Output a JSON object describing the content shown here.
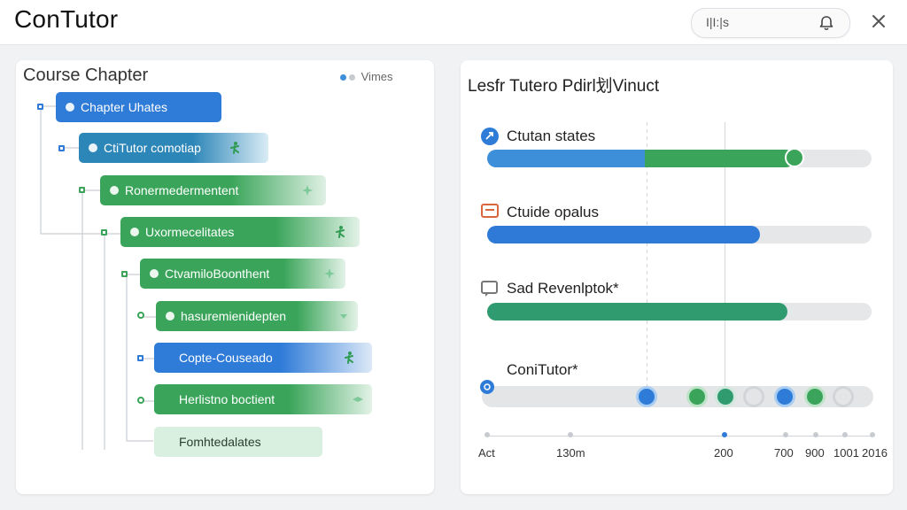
{
  "header": {
    "app_title": "ConTutor",
    "search_text": "I|I:|s"
  },
  "tree": {
    "title": "Course Chapter",
    "legend_label": "Vimes",
    "nodes": [
      {
        "label": "Chapter Uhates"
      },
      {
        "label": "CtiTutor comotiap"
      },
      {
        "label": "Ronermedermentent"
      },
      {
        "label": "Uxormecelitates"
      },
      {
        "label": "CtvamiloBoonthent"
      },
      {
        "label": "hasuremienidepten"
      },
      {
        "label": "Copte-Couseado"
      },
      {
        "label": "Herlistno boctient"
      },
      {
        "label": "Fomhtedalates"
      }
    ]
  },
  "progress": {
    "title": "Lesfr Tutero Pdirl划Vinuct",
    "rows": [
      {
        "label": "Ctutan states",
        "value": 0.8,
        "color": "#3d8fd9"
      },
      {
        "label": "Ctuide opalus",
        "value": 0.71,
        "color": "#2f7ad6"
      },
      {
        "label": "Sad Revenlptok*",
        "value": 0.78,
        "color": "#2f9b6e"
      }
    ],
    "timeline_label": "ConiTutor*",
    "axis_ticks": [
      "Act",
      "130m",
      "200",
      "700",
      "900",
      "1001",
      "2016"
    ],
    "colors": {
      "blue": "#2f7bd8",
      "green": "#3aa55a"
    }
  }
}
